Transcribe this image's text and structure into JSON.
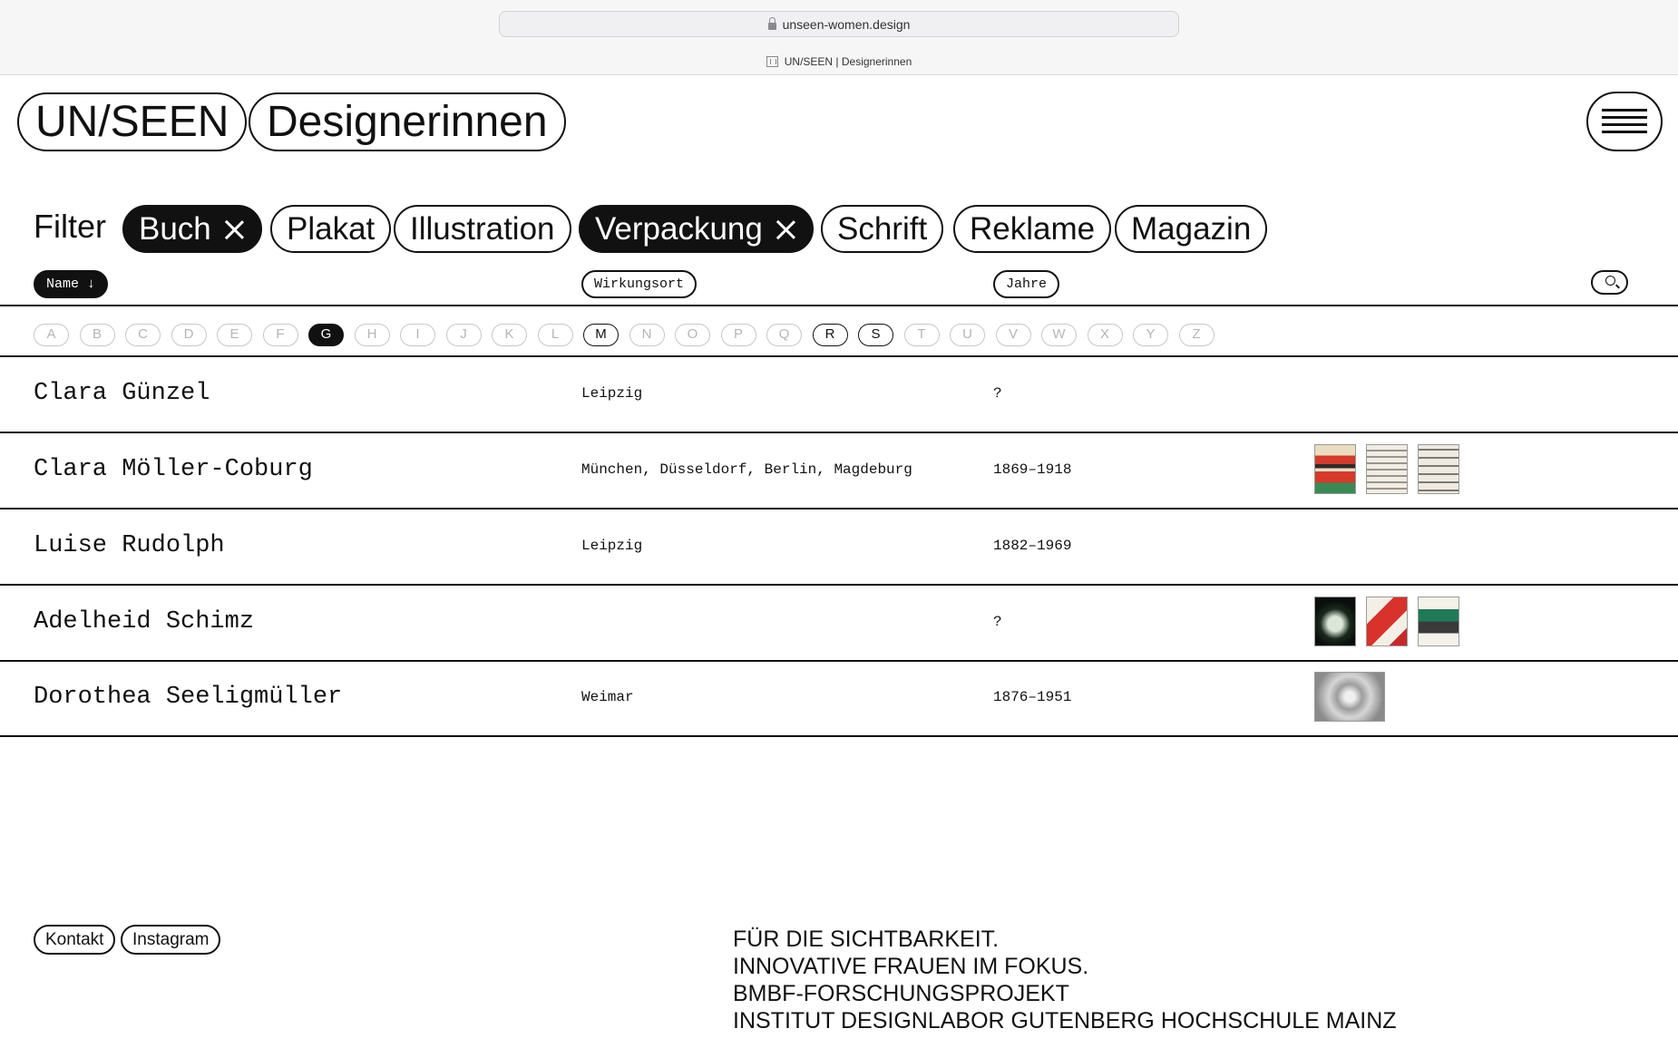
{
  "browser": {
    "url": "unseen-women.design",
    "tab_title": "UN/SEEN | Designerinnen"
  },
  "header": {
    "logo": "UN/SEEN",
    "section": "Designerinnen",
    "menu_icon": "hamburger-icon"
  },
  "filter": {
    "label": "Filter",
    "chips": [
      {
        "label": "Buch",
        "active": true
      },
      {
        "label": "Plakat",
        "active": false
      },
      {
        "label": "Illustration",
        "active": false
      },
      {
        "label": "Verpackung",
        "active": true
      },
      {
        "label": "Schrift",
        "active": false
      },
      {
        "label": "Reklame",
        "active": false
      },
      {
        "label": "Magazin",
        "active": false
      }
    ]
  },
  "columns": {
    "name": "Name ↓",
    "location": "Wirkungsort",
    "years": "Jahre",
    "search_icon": "search-icon"
  },
  "alphabet": {
    "letters": [
      "A",
      "B",
      "C",
      "D",
      "E",
      "F",
      "G",
      "H",
      "I",
      "J",
      "K",
      "L",
      "M",
      "N",
      "O",
      "P",
      "Q",
      "R",
      "S",
      "T",
      "U",
      "V",
      "W",
      "X",
      "Y",
      "Z"
    ],
    "selected": "G",
    "enabled": [
      "G",
      "M",
      "R",
      "S"
    ]
  },
  "rows": [
    {
      "name": "Clara Günzel",
      "location": "Leipzig",
      "years": "?",
      "thumbs": []
    },
    {
      "name": "Clara Möller-Coburg",
      "location": "München, Düsseldorf, Berlin, Magdeburg",
      "years": "1869–1918",
      "thumbs": [
        "poster-red-flower",
        "page-grey-1",
        "page-grey-2"
      ]
    },
    {
      "name": "Luise Rudolph",
      "location": "Leipzig",
      "years": "1882–1969",
      "thumbs": []
    },
    {
      "name": "Adelheid Schimz",
      "location": "",
      "years": "?",
      "thumbs": [
        "poster-dark-green",
        "poster-red-figure",
        "poster-green-building"
      ]
    },
    {
      "name": "Dorothea Seeligmüller",
      "location": "Weimar",
      "years": "1876–1951",
      "thumbs": [
        "print-grey-ornament"
      ]
    }
  ],
  "footer": {
    "links": [
      "Kontakt",
      "Instagram"
    ],
    "lines": [
      "FÜR DIE SICHTBARKEIT.",
      "INNOVATIVE FRAUEN IM FOKUS.",
      "BMBF-FORSCHUNGSPROJEKT",
      "INSTITUT DESIGNLABOR GUTENBERG HOCHSCHULE MAINZ"
    ]
  },
  "colors": {
    "ink": "#111111",
    "muted_letter": "#b5b5b5",
    "chrome_bg": "#f6f6f7"
  }
}
